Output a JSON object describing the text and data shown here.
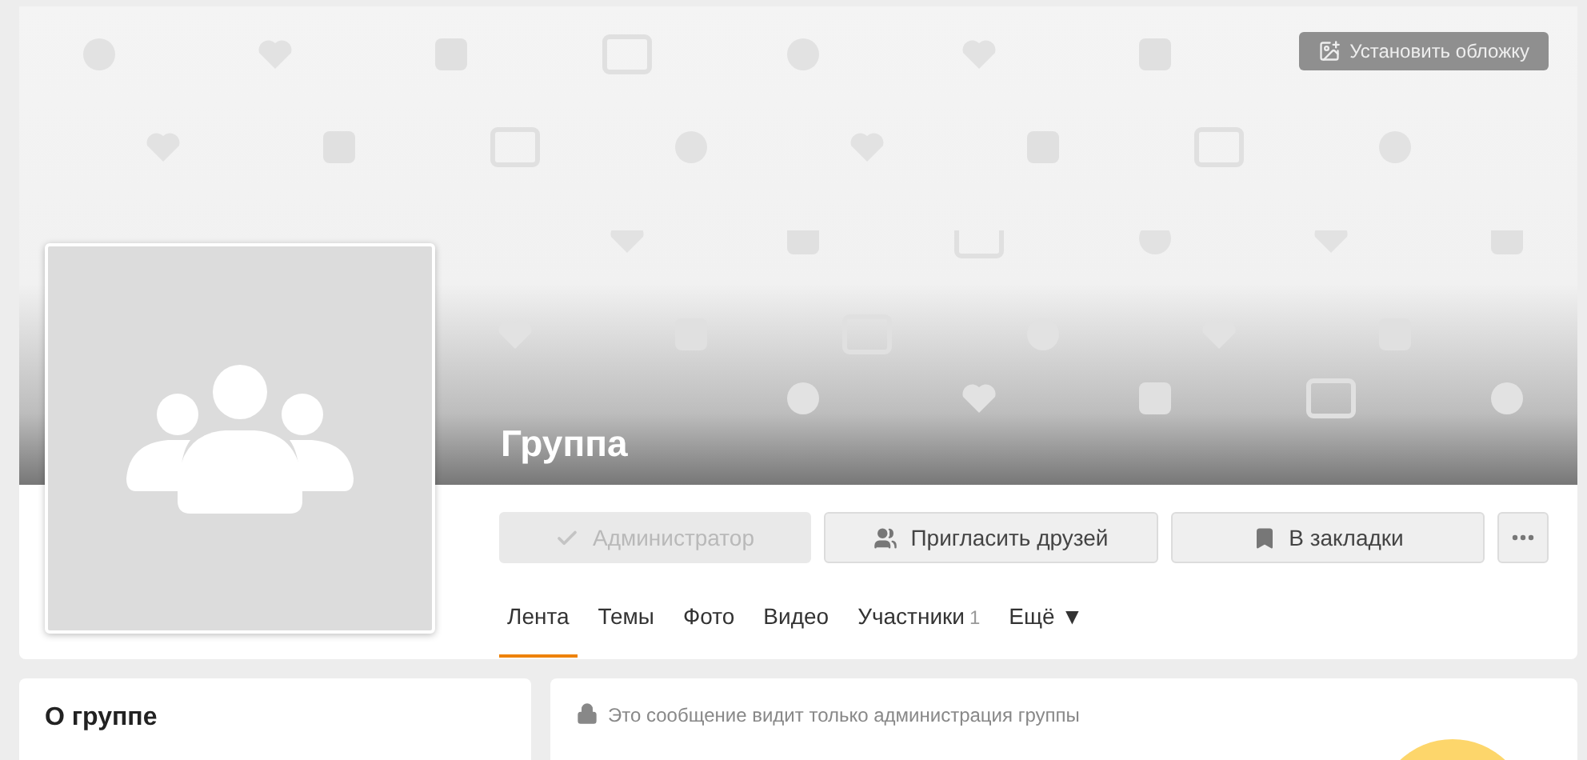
{
  "cover": {
    "button": "Установить обложку"
  },
  "group": {
    "title": "Группа"
  },
  "actions": [
    {
      "kind": "admin",
      "label": "Администратор",
      "disabled": true
    },
    {
      "kind": "invite",
      "label": "Пригласить друзей",
      "disabled": false
    },
    {
      "kind": "bookmark",
      "label": "В закладки",
      "disabled": false
    },
    {
      "kind": "more",
      "disabled": false
    }
  ],
  "tabs": [
    {
      "label": "Лента",
      "selected": true
    },
    {
      "label": "Темы",
      "selected": false
    },
    {
      "label": "Фото",
      "selected": false
    },
    {
      "label": "Видео",
      "selected": false
    },
    {
      "label": "Участники",
      "count": "1",
      "selected": false
    },
    {
      "label": "Ещё",
      "caret": "▼",
      "selected": false
    }
  ],
  "about": {
    "title": "О группе"
  },
  "notice": {
    "text": "Это сообщение видит только администрация группы"
  }
}
